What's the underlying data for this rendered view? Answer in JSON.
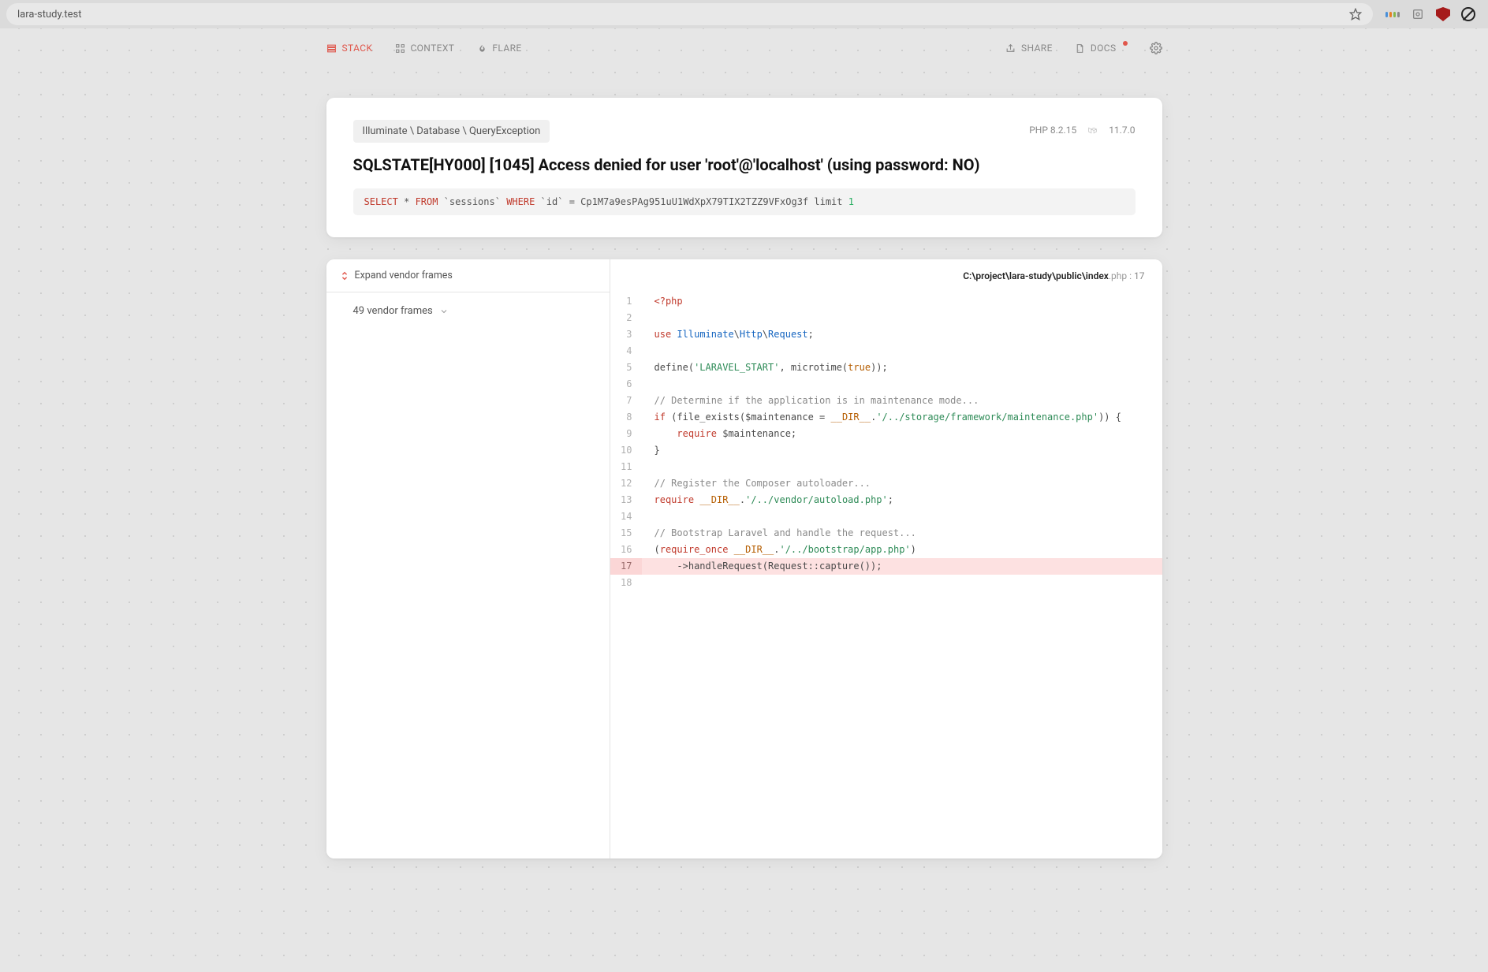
{
  "browser": {
    "url": "lara-study.test"
  },
  "nav": {
    "stack": "STACK",
    "context": "CONTEXT",
    "flare": "FLARE",
    "share": "SHARE",
    "docs": "DOCS"
  },
  "exception": {
    "class_path": "Illuminate \\ Database \\ QueryException",
    "php_version": "PHP 8.2.15",
    "laravel_version": "11.7.0",
    "title": "SQLSTATE[HY000] [1045] Access denied for user 'root'@'localhost' (using password: NO)",
    "sql": {
      "kw1": "SELECT",
      "star": "*",
      "kw2": "FROM",
      "tbl": "`sessions`",
      "kw3": "WHERE",
      "col": "`id`",
      "eq": "=",
      "val": "Cp1M7a9esPAg951uU1WdXpX79TIX2TZZ9VFxOg3f",
      "limit_kw": "limit",
      "limit_n": "1"
    }
  },
  "frames": {
    "expand_label": "Expand vendor frames",
    "summary": "49 vendor frames"
  },
  "file": {
    "dir": "C:\\project\\lara-study\\public\\",
    "name": "index",
    "ext": ".php",
    "line": "17"
  },
  "code": [
    {
      "n": 1,
      "t": "open",
      "v": "<?php"
    },
    {
      "n": 2,
      "t": "blank",
      "v": ""
    },
    {
      "n": 3,
      "t": "use",
      "kw": "use",
      "a": "Illuminate",
      "b": "Http",
      "c": "Request"
    },
    {
      "n": 4,
      "t": "blank",
      "v": ""
    },
    {
      "n": 5,
      "t": "define",
      "fn": "define",
      "str": "'LARAVEL_START'",
      "mid": ", microtime(",
      "tru": "true",
      "end": "));"
    },
    {
      "n": 6,
      "t": "blank",
      "v": ""
    },
    {
      "n": 7,
      "t": "comment",
      "v": "// Determine if the application is in maintenance mode..."
    },
    {
      "n": 8,
      "t": "if",
      "kw": "if",
      "open": " (file_exists(",
      "var": "$maintenance",
      "eq": " = ",
      "dir": "__DIR__",
      "dot": ".",
      "str": "'/../storage/framework/maintenance.php'",
      "close": ")) {"
    },
    {
      "n": 9,
      "t": "req",
      "indent": "    ",
      "kw": "require",
      "sp": " ",
      "var": "$maintenance",
      "end": ";"
    },
    {
      "n": 10,
      "t": "brace",
      "v": "}"
    },
    {
      "n": 11,
      "t": "blank",
      "v": ""
    },
    {
      "n": 12,
      "t": "comment",
      "v": "// Register the Composer autoloader..."
    },
    {
      "n": 13,
      "t": "req2",
      "kw": "require",
      "sp": " ",
      "dir": "__DIR__",
      "dot": ".",
      "str": "'/../vendor/autoload.php'",
      "end": ";"
    },
    {
      "n": 14,
      "t": "blank",
      "v": ""
    },
    {
      "n": 15,
      "t": "comment",
      "v": "// Bootstrap Laravel and handle the request..."
    },
    {
      "n": 16,
      "t": "reqonce",
      "open": "(",
      "kw": "require_once",
      "sp": " ",
      "dir": "__DIR__",
      "dot": ".",
      "str": "'/../bootstrap/app.php'",
      "close": ")"
    },
    {
      "n": 17,
      "t": "handle",
      "indent": "    ",
      "v": "->handleRequest(Request::capture());",
      "hl": true
    },
    {
      "n": 18,
      "t": "blank",
      "v": ""
    }
  ]
}
